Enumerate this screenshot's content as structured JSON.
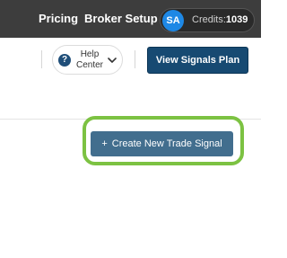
{
  "header": {
    "nav": [
      {
        "label": "Pricing"
      },
      {
        "label": "Broker Setup"
      }
    ],
    "avatar_initials": "SA",
    "credits_label": "Credits:",
    "credits_value": "1039"
  },
  "toolbar": {
    "help_line1": "Help",
    "help_line2": "Center",
    "help_icon_glyph": "?",
    "view_signals_label": "View Signals Plan"
  },
  "main": {
    "create_plus": "+",
    "create_label": "Create New Trade Signal"
  },
  "colors": {
    "topbar": "#3d3d3d",
    "avatar": "#1e88e5",
    "primary_button": "#174a72",
    "create_button": "#426e8e",
    "highlight": "#7cc242"
  },
  "icons": [
    "help-icon",
    "chevron-down-icon",
    "plus-icon"
  ]
}
